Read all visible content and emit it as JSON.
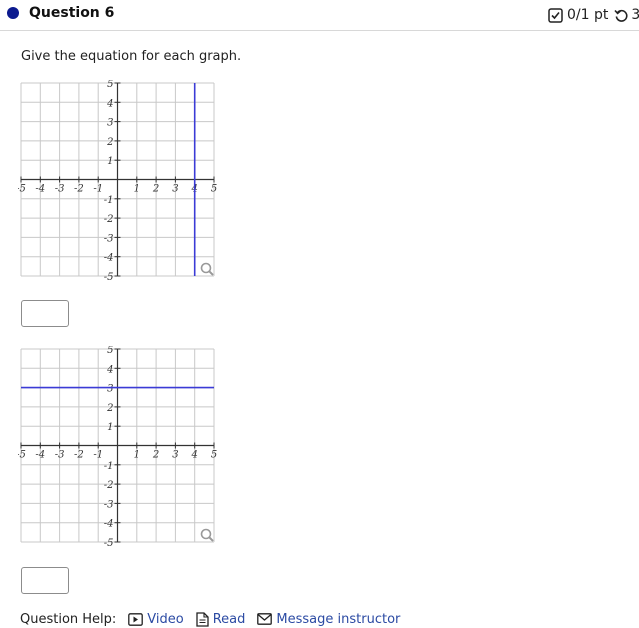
{
  "question": {
    "title": "Question 6",
    "score": "0/1 pt",
    "score_tail": "3",
    "prompt": "Give the equation for each graph."
  },
  "graphs": [
    {
      "x_ticks": [
        "-5",
        "-4",
        "-3",
        "-2",
        "-1",
        "1",
        "2",
        "3",
        "4",
        "5"
      ],
      "y_ticks": [
        "5",
        "4",
        "3",
        "2",
        "1",
        "-1",
        "-2",
        "-3",
        "-4",
        "-5"
      ],
      "range": [
        -5,
        5
      ],
      "line": {
        "type": "vertical",
        "x": 4,
        "color": "#3b3bd6"
      }
    },
    {
      "x_ticks": [
        "-5",
        "-4",
        "-3",
        "-2",
        "-1",
        "1",
        "2",
        "3",
        "4",
        "5"
      ],
      "y_ticks": [
        "5",
        "4",
        "3",
        "2",
        "1",
        "-1",
        "-2",
        "-3",
        "-4",
        "-5"
      ],
      "range": [
        -5,
        5
      ],
      "line": {
        "type": "horizontal",
        "y": 3,
        "color": "#3b3bd6"
      }
    }
  ],
  "answers": [
    "",
    ""
  ],
  "help": {
    "label": "Question Help:",
    "video": "Video",
    "read": "Read",
    "message": "Message instructor"
  },
  "colors": {
    "accent": "#0c1a8f",
    "link": "#2b4aa3",
    "grid": "#c8c8c8",
    "graph_line": "#3b3bd6"
  },
  "icons": {
    "score": "checkbox-icon",
    "retry": "retry-icon",
    "zoom": "magnifier-icon",
    "video": "video-icon",
    "read": "document-icon",
    "message": "mail-icon"
  }
}
